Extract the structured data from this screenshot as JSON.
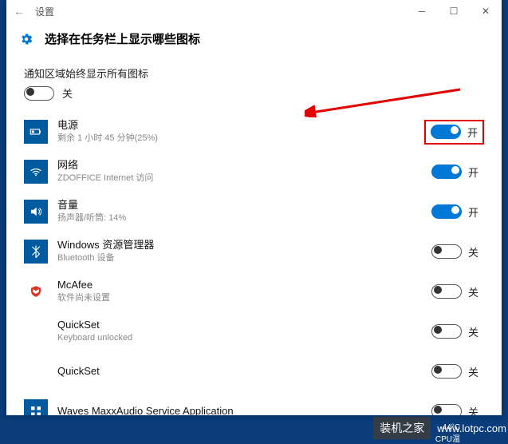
{
  "titlebar": {
    "back": "←",
    "title": "设置"
  },
  "header": {
    "title": "选择在任务栏上显示哪些图标"
  },
  "master": {
    "label": "通知区域始终显示所有图标",
    "state": "关"
  },
  "state_on": "开",
  "state_off": "关",
  "items": [
    {
      "icon": "battery-icon",
      "title": "电源",
      "sub": "剩余 1 小时 45 分钟(25%)",
      "on": true,
      "highlight": true
    },
    {
      "icon": "wifi-icon",
      "title": "网络",
      "sub": "ZDOFFICE Internet 访问",
      "on": true
    },
    {
      "icon": "speaker-icon",
      "title": "音量",
      "sub": "扬声器/听筒: 14%",
      "on": true
    },
    {
      "icon": "bluetooth-icon",
      "title": "Windows 资源管理器",
      "sub": "Bluetooth 设备",
      "on": false
    },
    {
      "icon": "mcafee-icon",
      "title": "McAfee",
      "sub": "软件尚未设置",
      "on": false
    },
    {
      "icon": "blank-icon",
      "title": "QuickSet",
      "sub": "Keyboard unlocked",
      "on": false
    },
    {
      "icon": "blank-icon",
      "title": "QuickSet",
      "sub": "",
      "on": false
    },
    {
      "icon": "waves-icon",
      "title": "Waves MaxxAudio Service Application",
      "sub": "",
      "on": false
    }
  ],
  "tray": {
    "line1": "44°C",
    "line2": "CPU温"
  },
  "watermark": {
    "label": "装机之家",
    "url": "www.lotpc.com"
  }
}
